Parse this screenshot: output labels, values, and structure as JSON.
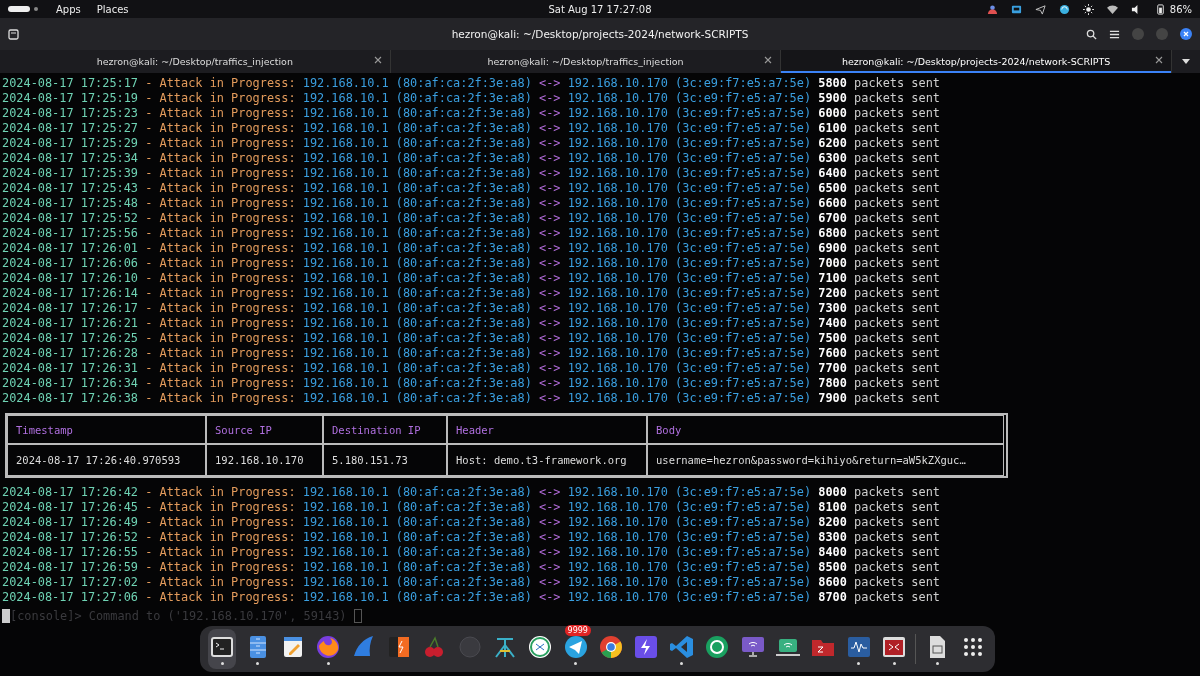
{
  "top_bar": {
    "menus": [
      "Apps",
      "Places"
    ],
    "clock": "Sat Aug 17 17:27:08",
    "battery": "86%"
  },
  "window": {
    "title": "hezron@kali: ~/Desktop/projects-2024/network-SCRIPTS"
  },
  "tabs": [
    {
      "label": "hezron@kali: ~/Desktop/traffics_injection",
      "selected": false
    },
    {
      "label": "hezron@kali: ~/Desktop/traffics_injection",
      "selected": false
    },
    {
      "label": "hezron@kali: ~/Desktop/projects-2024/network-SCRIPTS",
      "selected": true
    }
  ],
  "log_before": [
    {
      "timestamp": "2024-08-17 17:25:17",
      "message": "- Attack in Progress:",
      "src_ip": "192.168.10.1",
      "src_mac": "(80:af:ca:2f:3e:a8)",
      "arrow": "<->",
      "dst_ip": "192.168.10.170",
      "dst_mac": "(3c:e9:f7:e5:a7:5e)",
      "count": "5800",
      "suffix": "packets sent"
    },
    {
      "timestamp": "2024-08-17 17:25:19",
      "message": "- Attack in Progress:",
      "src_ip": "192.168.10.1",
      "src_mac": "(80:af:ca:2f:3e:a8)",
      "arrow": "<->",
      "dst_ip": "192.168.10.170",
      "dst_mac": "(3c:e9:f7:e5:a7:5e)",
      "count": "5900",
      "suffix": "packets sent"
    },
    {
      "timestamp": "2024-08-17 17:25:23",
      "message": "- Attack in Progress:",
      "src_ip": "192.168.10.1",
      "src_mac": "(80:af:ca:2f:3e:a8)",
      "arrow": "<->",
      "dst_ip": "192.168.10.170",
      "dst_mac": "(3c:e9:f7:e5:a7:5e)",
      "count": "6000",
      "suffix": "packets sent"
    },
    {
      "timestamp": "2024-08-17 17:25:27",
      "message": "- Attack in Progress:",
      "src_ip": "192.168.10.1",
      "src_mac": "(80:af:ca:2f:3e:a8)",
      "arrow": "<->",
      "dst_ip": "192.168.10.170",
      "dst_mac": "(3c:e9:f7:e5:a7:5e)",
      "count": "6100",
      "suffix": "packets sent"
    },
    {
      "timestamp": "2024-08-17 17:25:29",
      "message": "- Attack in Progress:",
      "src_ip": "192.168.10.1",
      "src_mac": "(80:af:ca:2f:3e:a8)",
      "arrow": "<->",
      "dst_ip": "192.168.10.170",
      "dst_mac": "(3c:e9:f7:e5:a7:5e)",
      "count": "6200",
      "suffix": "packets sent"
    },
    {
      "timestamp": "2024-08-17 17:25:34",
      "message": "- Attack in Progress:",
      "src_ip": "192.168.10.1",
      "src_mac": "(80:af:ca:2f:3e:a8)",
      "arrow": "<->",
      "dst_ip": "192.168.10.170",
      "dst_mac": "(3c:e9:f7:e5:a7:5e)",
      "count": "6300",
      "suffix": "packets sent"
    },
    {
      "timestamp": "2024-08-17 17:25:39",
      "message": "- Attack in Progress:",
      "src_ip": "192.168.10.1",
      "src_mac": "(80:af:ca:2f:3e:a8)",
      "arrow": "<->",
      "dst_ip": "192.168.10.170",
      "dst_mac": "(3c:e9:f7:e5:a7:5e)",
      "count": "6400",
      "suffix": "packets sent"
    },
    {
      "timestamp": "2024-08-17 17:25:43",
      "message": "- Attack in Progress:",
      "src_ip": "192.168.10.1",
      "src_mac": "(80:af:ca:2f:3e:a8)",
      "arrow": "<->",
      "dst_ip": "192.168.10.170",
      "dst_mac": "(3c:e9:f7:e5:a7:5e)",
      "count": "6500",
      "suffix": "packets sent"
    },
    {
      "timestamp": "2024-08-17 17:25:48",
      "message": "- Attack in Progress:",
      "src_ip": "192.168.10.1",
      "src_mac": "(80:af:ca:2f:3e:a8)",
      "arrow": "<->",
      "dst_ip": "192.168.10.170",
      "dst_mac": "(3c:e9:f7:e5:a7:5e)",
      "count": "6600",
      "suffix": "packets sent"
    },
    {
      "timestamp": "2024-08-17 17:25:52",
      "message": "- Attack in Progress:",
      "src_ip": "192.168.10.1",
      "src_mac": "(80:af:ca:2f:3e:a8)",
      "arrow": "<->",
      "dst_ip": "192.168.10.170",
      "dst_mac": "(3c:e9:f7:e5:a7:5e)",
      "count": "6700",
      "suffix": "packets sent"
    },
    {
      "timestamp": "2024-08-17 17:25:56",
      "message": "- Attack in Progress:",
      "src_ip": "192.168.10.1",
      "src_mac": "(80:af:ca:2f:3e:a8)",
      "arrow": "<->",
      "dst_ip": "192.168.10.170",
      "dst_mac": "(3c:e9:f7:e5:a7:5e)",
      "count": "6800",
      "suffix": "packets sent"
    },
    {
      "timestamp": "2024-08-17 17:26:01",
      "message": "- Attack in Progress:",
      "src_ip": "192.168.10.1",
      "src_mac": "(80:af:ca:2f:3e:a8)",
      "arrow": "<->",
      "dst_ip": "192.168.10.170",
      "dst_mac": "(3c:e9:f7:e5:a7:5e)",
      "count": "6900",
      "suffix": "packets sent"
    },
    {
      "timestamp": "2024-08-17 17:26:06",
      "message": "- Attack in Progress:",
      "src_ip": "192.168.10.1",
      "src_mac": "(80:af:ca:2f:3e:a8)",
      "arrow": "<->",
      "dst_ip": "192.168.10.170",
      "dst_mac": "(3c:e9:f7:e5:a7:5e)",
      "count": "7000",
      "suffix": "packets sent"
    },
    {
      "timestamp": "2024-08-17 17:26:10",
      "message": "- Attack in Progress:",
      "src_ip": "192.168.10.1",
      "src_mac": "(80:af:ca:2f:3e:a8)",
      "arrow": "<->",
      "dst_ip": "192.168.10.170",
      "dst_mac": "(3c:e9:f7:e5:a7:5e)",
      "count": "7100",
      "suffix": "packets sent"
    },
    {
      "timestamp": "2024-08-17 17:26:14",
      "message": "- Attack in Progress:",
      "src_ip": "192.168.10.1",
      "src_mac": "(80:af:ca:2f:3e:a8)",
      "arrow": "<->",
      "dst_ip": "192.168.10.170",
      "dst_mac": "(3c:e9:f7:e5:a7:5e)",
      "count": "7200",
      "suffix": "packets sent"
    },
    {
      "timestamp": "2024-08-17 17:26:17",
      "message": "- Attack in Progress:",
      "src_ip": "192.168.10.1",
      "src_mac": "(80:af:ca:2f:3e:a8)",
      "arrow": "<->",
      "dst_ip": "192.168.10.170",
      "dst_mac": "(3c:e9:f7:e5:a7:5e)",
      "count": "7300",
      "suffix": "packets sent"
    },
    {
      "timestamp": "2024-08-17 17:26:21",
      "message": "- Attack in Progress:",
      "src_ip": "192.168.10.1",
      "src_mac": "(80:af:ca:2f:3e:a8)",
      "arrow": "<->",
      "dst_ip": "192.168.10.170",
      "dst_mac": "(3c:e9:f7:e5:a7:5e)",
      "count": "7400",
      "suffix": "packets sent"
    },
    {
      "timestamp": "2024-08-17 17:26:25",
      "message": "- Attack in Progress:",
      "src_ip": "192.168.10.1",
      "src_mac": "(80:af:ca:2f:3e:a8)",
      "arrow": "<->",
      "dst_ip": "192.168.10.170",
      "dst_mac": "(3c:e9:f7:e5:a7:5e)",
      "count": "7500",
      "suffix": "packets sent"
    },
    {
      "timestamp": "2024-08-17 17:26:28",
      "message": "- Attack in Progress:",
      "src_ip": "192.168.10.1",
      "src_mac": "(80:af:ca:2f:3e:a8)",
      "arrow": "<->",
      "dst_ip": "192.168.10.170",
      "dst_mac": "(3c:e9:f7:e5:a7:5e)",
      "count": "7600",
      "suffix": "packets sent"
    },
    {
      "timestamp": "2024-08-17 17:26:31",
      "message": "- Attack in Progress:",
      "src_ip": "192.168.10.1",
      "src_mac": "(80:af:ca:2f:3e:a8)",
      "arrow": "<->",
      "dst_ip": "192.168.10.170",
      "dst_mac": "(3c:e9:f7:e5:a7:5e)",
      "count": "7700",
      "suffix": "packets sent"
    },
    {
      "timestamp": "2024-08-17 17:26:34",
      "message": "- Attack in Progress:",
      "src_ip": "192.168.10.1",
      "src_mac": "(80:af:ca:2f:3e:a8)",
      "arrow": "<->",
      "dst_ip": "192.168.10.170",
      "dst_mac": "(3c:e9:f7:e5:a7:5e)",
      "count": "7800",
      "suffix": "packets sent"
    },
    {
      "timestamp": "2024-08-17 17:26:38",
      "message": "- Attack in Progress:",
      "src_ip": "192.168.10.1",
      "src_mac": "(80:af:ca:2f:3e:a8)",
      "arrow": "<->",
      "dst_ip": "192.168.10.170",
      "dst_mac": "(3c:e9:f7:e5:a7:5e)",
      "count": "7900",
      "suffix": "packets sent"
    }
  ],
  "capture_table": {
    "columns": [
      "Timestamp",
      "Source IP",
      "Destination IP",
      "Header",
      "Body"
    ],
    "rows": [
      [
        "2024-08-17 17:26:40.970593",
        "192.168.10.170",
        "5.180.151.73",
        "Host: demo.t3-framework.org",
        "username=hezron&password=kihiyo&return=aW5kZXguc…"
      ]
    ]
  },
  "log_after": [
    {
      "timestamp": "2024-08-17 17:26:42",
      "message": "- Attack in Progress:",
      "src_ip": "192.168.10.1",
      "src_mac": "(80:af:ca:2f:3e:a8)",
      "arrow": "<->",
      "dst_ip": "192.168.10.170",
      "dst_mac": "(3c:e9:f7:e5:a7:5e)",
      "count": "8000",
      "suffix": "packets sent"
    },
    {
      "timestamp": "2024-08-17 17:26:45",
      "message": "- Attack in Progress:",
      "src_ip": "192.168.10.1",
      "src_mac": "(80:af:ca:2f:3e:a8)",
      "arrow": "<->",
      "dst_ip": "192.168.10.170",
      "dst_mac": "(3c:e9:f7:e5:a7:5e)",
      "count": "8100",
      "suffix": "packets sent"
    },
    {
      "timestamp": "2024-08-17 17:26:49",
      "message": "- Attack in Progress:",
      "src_ip": "192.168.10.1",
      "src_mac": "(80:af:ca:2f:3e:a8)",
      "arrow": "<->",
      "dst_ip": "192.168.10.170",
      "dst_mac": "(3c:e9:f7:e5:a7:5e)",
      "count": "8200",
      "suffix": "packets sent"
    },
    {
      "timestamp": "2024-08-17 17:26:52",
      "message": "- Attack in Progress:",
      "src_ip": "192.168.10.1",
      "src_mac": "(80:af:ca:2f:3e:a8)",
      "arrow": "<->",
      "dst_ip": "192.168.10.170",
      "dst_mac": "(3c:e9:f7:e5:a7:5e)",
      "count": "8300",
      "suffix": "packets sent"
    },
    {
      "timestamp": "2024-08-17 17:26:55",
      "message": "- Attack in Progress:",
      "src_ip": "192.168.10.1",
      "src_mac": "(80:af:ca:2f:3e:a8)",
      "arrow": "<->",
      "dst_ip": "192.168.10.170",
      "dst_mac": "(3c:e9:f7:e5:a7:5e)",
      "count": "8400",
      "suffix": "packets sent"
    },
    {
      "timestamp": "2024-08-17 17:26:59",
      "message": "- Attack in Progress:",
      "src_ip": "192.168.10.1",
      "src_mac": "(80:af:ca:2f:3e:a8)",
      "arrow": "<->",
      "dst_ip": "192.168.10.170",
      "dst_mac": "(3c:e9:f7:e5:a7:5e)",
      "count": "8500",
      "suffix": "packets sent"
    },
    {
      "timestamp": "2024-08-17 17:27:02",
      "message": "- Attack in Progress:",
      "src_ip": "192.168.10.1",
      "src_mac": "(80:af:ca:2f:3e:a8)",
      "arrow": "<->",
      "dst_ip": "192.168.10.170",
      "dst_mac": "(3c:e9:f7:e5:a7:5e)",
      "count": "8600",
      "suffix": "packets sent"
    },
    {
      "timestamp": "2024-08-17 17:27:06",
      "message": "- Attack in Progress:",
      "src_ip": "192.168.10.1",
      "src_mac": "(80:af:ca:2f:3e:a8)",
      "arrow": "<->",
      "dst_ip": "192.168.10.170",
      "dst_mac": "(3c:e9:f7:e5:a7:5e)",
      "count": "8700",
      "suffix": "packets sent"
    }
  ],
  "console_line": "[console]> Command to ('192.168.10.170', 59143)",
  "dock": [
    {
      "kind": "terminal",
      "running": true,
      "selected": true
    },
    {
      "kind": "files",
      "running": true,
      "selected": false
    },
    {
      "kind": "editor",
      "running": false,
      "selected": false
    },
    {
      "kind": "firefox",
      "running": true,
      "selected": false
    },
    {
      "kind": "fin",
      "running": false,
      "selected": false
    },
    {
      "kind": "burp",
      "running": false,
      "selected": false
    },
    {
      "kind": "cherry",
      "running": false,
      "selected": false
    },
    {
      "kind": "dim",
      "running": false,
      "selected": false
    },
    {
      "kind": "tripod",
      "running": false,
      "selected": false
    },
    {
      "kind": "remote",
      "running": false,
      "selected": false
    },
    {
      "kind": "telegram",
      "running": true,
      "selected": false,
      "badge": "9999"
    },
    {
      "kind": "chrome",
      "running": false,
      "selected": false
    },
    {
      "kind": "bolt",
      "running": false,
      "selected": false
    },
    {
      "kind": "vscode",
      "running": true,
      "selected": false
    },
    {
      "kind": "greencircle",
      "running": false,
      "selected": false
    },
    {
      "kind": "monitor",
      "running": false,
      "selected": false
    },
    {
      "kind": "laptop",
      "running": false,
      "selected": false
    },
    {
      "kind": "filezilla",
      "running": false,
      "selected": false
    },
    {
      "kind": "wave",
      "running": true,
      "selected": false
    },
    {
      "kind": "redwin",
      "running": true,
      "selected": false
    },
    {
      "kind": "doc",
      "running": true,
      "selected": false
    },
    {
      "kind": "grid",
      "running": false,
      "selected": false
    }
  ]
}
